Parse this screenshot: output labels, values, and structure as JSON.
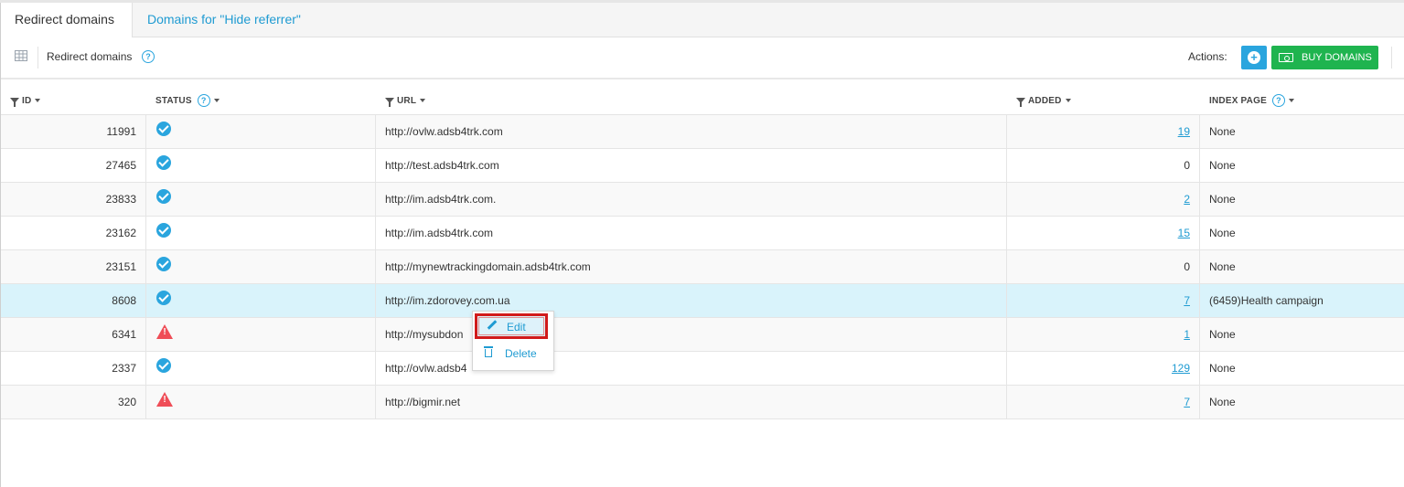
{
  "tabs": [
    {
      "label": "Redirect domains"
    },
    {
      "label": "Domains for \"Hide referrer\""
    }
  ],
  "toolbar": {
    "title": "Redirect domains",
    "help": "?",
    "actions_label": "Actions:",
    "add_icon": "+",
    "buy_label": "BUY DOMAINS"
  },
  "columns": {
    "id": "ID",
    "status": "STATUS",
    "url": "URL",
    "added": "ADDED",
    "index_page": "INDEX PAGE",
    "help": "?"
  },
  "rows": [
    {
      "id": "11991",
      "status": "ok",
      "url": "http://ovlw.adsb4trk.com",
      "added": "19",
      "added_link": true,
      "index_page": "None"
    },
    {
      "id": "27465",
      "status": "ok",
      "url": "http://test.adsb4trk.com",
      "added": "0",
      "added_link": false,
      "index_page": "None"
    },
    {
      "id": "23833",
      "status": "ok",
      "url": "http://im.adsb4trk.com.",
      "added": "2",
      "added_link": true,
      "index_page": "None"
    },
    {
      "id": "23162",
      "status": "ok",
      "url": "http://im.adsb4trk.com",
      "added": "15",
      "added_link": true,
      "index_page": "None"
    },
    {
      "id": "23151",
      "status": "ok",
      "url": "http://mynewtrackingdomain.adsb4trk.com",
      "added": "0",
      "added_link": false,
      "index_page": "None"
    },
    {
      "id": "8608",
      "status": "ok",
      "url": "http://im.zdorovey.com.ua",
      "added": "7",
      "added_link": true,
      "index_page": "(6459)Health campaign"
    },
    {
      "id": "6341",
      "status": "warning",
      "url": "http://mysubdon",
      "added": "1",
      "added_link": true,
      "index_page": "None"
    },
    {
      "id": "2337",
      "status": "ok",
      "url": "http://ovlw.adsb4",
      "added": "129",
      "added_link": true,
      "index_page": "None"
    },
    {
      "id": "320",
      "status": "warning",
      "url": "http://bigmir.net",
      "added": "7",
      "added_link": true,
      "index_page": "None"
    }
  ],
  "context_menu": {
    "edit_label": "Edit",
    "delete_label": "Delete"
  },
  "colors": {
    "accent": "#1f9bd2",
    "ok": "#2aa5de",
    "warning": "#ef4d57",
    "buy": "#1fb44f",
    "highlight_row": "#d9f3fb",
    "callout": "#d11a1a"
  },
  "icons": {
    "grid": "grid-icon",
    "filter": "filter-icon",
    "ok": "check-circle-icon",
    "warning": "warning-triangle-icon",
    "edit": "pencil-icon",
    "delete": "trash-icon",
    "add": "plus-circle-icon",
    "buy": "money-icon"
  }
}
